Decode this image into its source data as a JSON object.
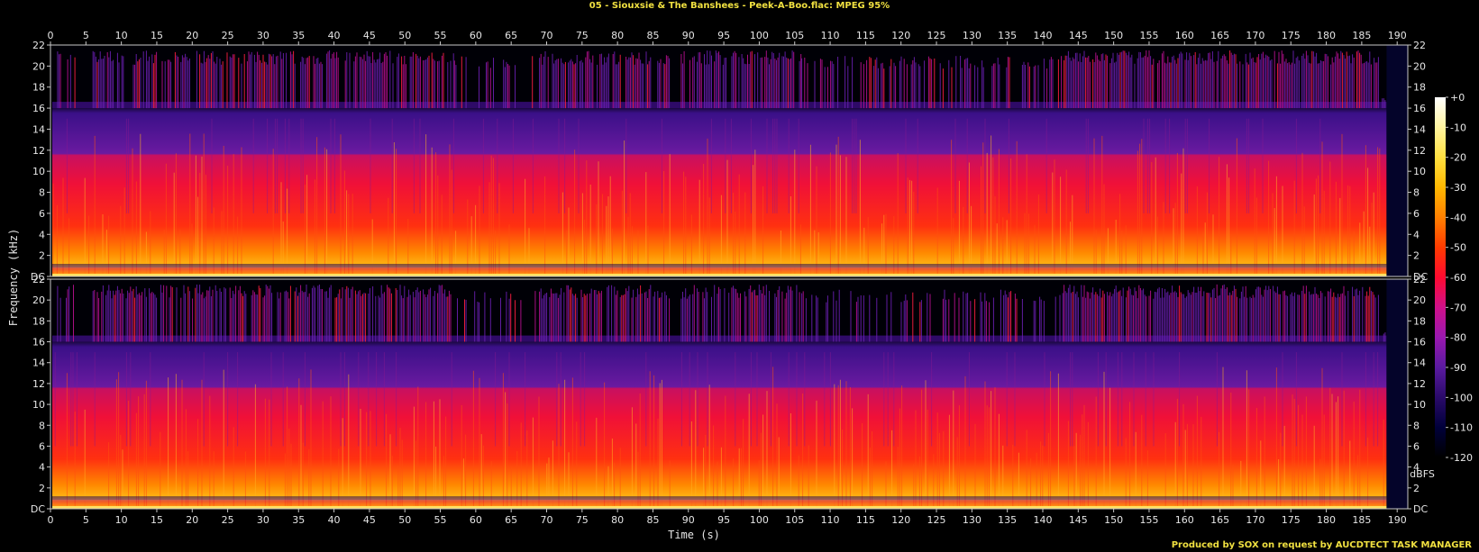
{
  "title": "05 - Siouxsie & The Banshees - Peek-A-Boo.flac: MPEG 95%",
  "footer": "Produced by SOX on request by AUCDTECT TASK MANAGER",
  "chart_data": {
    "type": "heatmap",
    "xlabel": "Time (s)",
    "ylabel": "Frequency (kHz)",
    "xlim": [
      0,
      191.5
    ],
    "ylim": [
      0,
      22
    ],
    "x_ticks": [
      0,
      5,
      10,
      15,
      20,
      25,
      30,
      35,
      40,
      45,
      50,
      55,
      60,
      65,
      70,
      75,
      80,
      85,
      90,
      95,
      100,
      105,
      110,
      115,
      120,
      125,
      130,
      135,
      140,
      145,
      150,
      155,
      160,
      165,
      170,
      175,
      180,
      185,
      190
    ],
    "y_tick_labels": [
      "DC",
      "2",
      "4",
      "6",
      "8",
      "10",
      "12",
      "14",
      "16",
      "18",
      "20",
      "22"
    ],
    "y_ticks": [
      0,
      2,
      4,
      6,
      8,
      10,
      12,
      14,
      16,
      18,
      20,
      22
    ],
    "channels": [
      "left",
      "right"
    ],
    "colorbar": {
      "label": "dBFS",
      "ticks": [
        "+0",
        "-10",
        "-20",
        "-30",
        "-40",
        "-50",
        "-60",
        "-70",
        "-80",
        "-90",
        "-100",
        "-110",
        "-120"
      ],
      "range": [
        -120,
        0
      ],
      "colors": [
        "#000000",
        "#00003a",
        "#2a0a6a",
        "#5a1aa0",
        "#9a18b0",
        "#d0108a",
        "#ff0a30",
        "#ff3a00",
        "#ff8000",
        "#ffb800",
        "#ffe040",
        "#fff4a0",
        "#ffffff"
      ]
    },
    "lowpass_cutoff_khz": 16,
    "upper_band_regions": [
      {
        "start": 1.0,
        "end": 4.0,
        "max_khz": 21.5,
        "density": 0.4
      },
      {
        "start": 4.0,
        "end": 6.0,
        "max_khz": 16.0,
        "density": 0.1
      },
      {
        "start": 6.0,
        "end": 57.0,
        "max_khz": 21.5,
        "density": 0.75
      },
      {
        "start": 57.0,
        "end": 69.0,
        "max_khz": 21.0,
        "density": 0.3
      },
      {
        "start": 69.0,
        "end": 87.5,
        "max_khz": 21.5,
        "density": 0.8
      },
      {
        "start": 87.5,
        "end": 89.0,
        "max_khz": 16.0,
        "density": 0.1
      },
      {
        "start": 89.0,
        "end": 106.0,
        "max_khz": 21.5,
        "density": 0.75
      },
      {
        "start": 106.0,
        "end": 143.0,
        "max_khz": 21.0,
        "density": 0.4
      },
      {
        "start": 143.0,
        "end": 187.5,
        "max_khz": 21.5,
        "density": 0.9
      },
      {
        "start": 187.5,
        "end": 188.5,
        "max_khz": 17.0,
        "density": 0.2
      }
    ],
    "track_end_s": 188.5
  }
}
